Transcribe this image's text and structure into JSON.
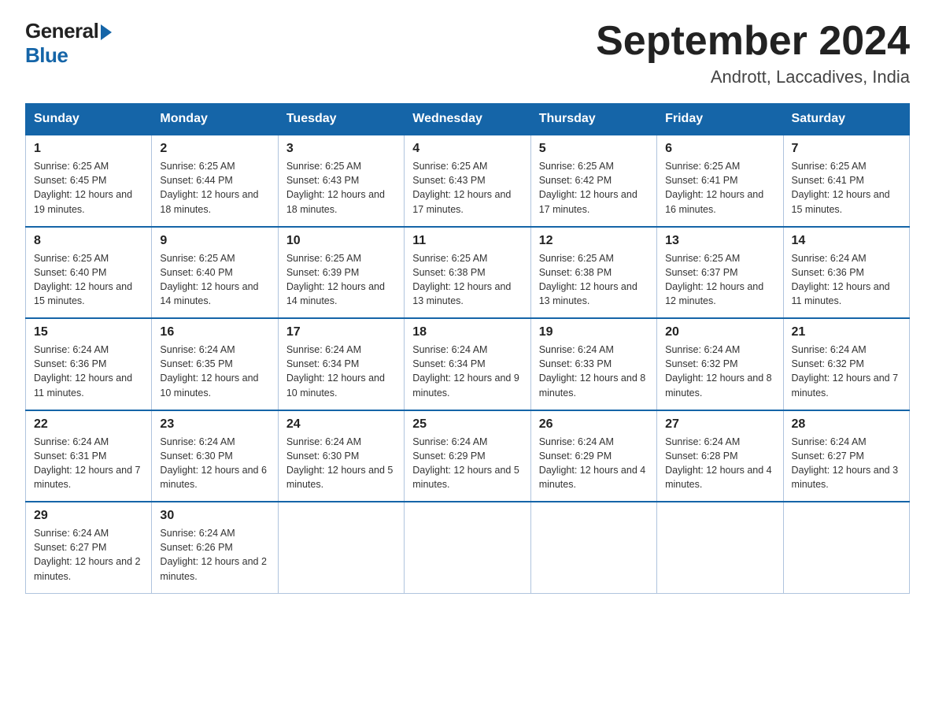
{
  "logo": {
    "text_general": "General",
    "text_blue": "Blue"
  },
  "title": "September 2024",
  "subtitle": "Andrott, Laccadives, India",
  "days_of_week": [
    "Sunday",
    "Monday",
    "Tuesday",
    "Wednesday",
    "Thursday",
    "Friday",
    "Saturday"
  ],
  "weeks": [
    [
      {
        "day": "1",
        "sunrise": "6:25 AM",
        "sunset": "6:45 PM",
        "daylight": "12 hours and 19 minutes."
      },
      {
        "day": "2",
        "sunrise": "6:25 AM",
        "sunset": "6:44 PM",
        "daylight": "12 hours and 18 minutes."
      },
      {
        "day": "3",
        "sunrise": "6:25 AM",
        "sunset": "6:43 PM",
        "daylight": "12 hours and 18 minutes."
      },
      {
        "day": "4",
        "sunrise": "6:25 AM",
        "sunset": "6:43 PM",
        "daylight": "12 hours and 17 minutes."
      },
      {
        "day": "5",
        "sunrise": "6:25 AM",
        "sunset": "6:42 PM",
        "daylight": "12 hours and 17 minutes."
      },
      {
        "day": "6",
        "sunrise": "6:25 AM",
        "sunset": "6:41 PM",
        "daylight": "12 hours and 16 minutes."
      },
      {
        "day": "7",
        "sunrise": "6:25 AM",
        "sunset": "6:41 PM",
        "daylight": "12 hours and 15 minutes."
      }
    ],
    [
      {
        "day": "8",
        "sunrise": "6:25 AM",
        "sunset": "6:40 PM",
        "daylight": "12 hours and 15 minutes."
      },
      {
        "day": "9",
        "sunrise": "6:25 AM",
        "sunset": "6:40 PM",
        "daylight": "12 hours and 14 minutes."
      },
      {
        "day": "10",
        "sunrise": "6:25 AM",
        "sunset": "6:39 PM",
        "daylight": "12 hours and 14 minutes."
      },
      {
        "day": "11",
        "sunrise": "6:25 AM",
        "sunset": "6:38 PM",
        "daylight": "12 hours and 13 minutes."
      },
      {
        "day": "12",
        "sunrise": "6:25 AM",
        "sunset": "6:38 PM",
        "daylight": "12 hours and 13 minutes."
      },
      {
        "day": "13",
        "sunrise": "6:25 AM",
        "sunset": "6:37 PM",
        "daylight": "12 hours and 12 minutes."
      },
      {
        "day": "14",
        "sunrise": "6:24 AM",
        "sunset": "6:36 PM",
        "daylight": "12 hours and 11 minutes."
      }
    ],
    [
      {
        "day": "15",
        "sunrise": "6:24 AM",
        "sunset": "6:36 PM",
        "daylight": "12 hours and 11 minutes."
      },
      {
        "day": "16",
        "sunrise": "6:24 AM",
        "sunset": "6:35 PM",
        "daylight": "12 hours and 10 minutes."
      },
      {
        "day": "17",
        "sunrise": "6:24 AM",
        "sunset": "6:34 PM",
        "daylight": "12 hours and 10 minutes."
      },
      {
        "day": "18",
        "sunrise": "6:24 AM",
        "sunset": "6:34 PM",
        "daylight": "12 hours and 9 minutes."
      },
      {
        "day": "19",
        "sunrise": "6:24 AM",
        "sunset": "6:33 PM",
        "daylight": "12 hours and 8 minutes."
      },
      {
        "day": "20",
        "sunrise": "6:24 AM",
        "sunset": "6:32 PM",
        "daylight": "12 hours and 8 minutes."
      },
      {
        "day": "21",
        "sunrise": "6:24 AM",
        "sunset": "6:32 PM",
        "daylight": "12 hours and 7 minutes."
      }
    ],
    [
      {
        "day": "22",
        "sunrise": "6:24 AM",
        "sunset": "6:31 PM",
        "daylight": "12 hours and 7 minutes."
      },
      {
        "day": "23",
        "sunrise": "6:24 AM",
        "sunset": "6:30 PM",
        "daylight": "12 hours and 6 minutes."
      },
      {
        "day": "24",
        "sunrise": "6:24 AM",
        "sunset": "6:30 PM",
        "daylight": "12 hours and 5 minutes."
      },
      {
        "day": "25",
        "sunrise": "6:24 AM",
        "sunset": "6:29 PM",
        "daylight": "12 hours and 5 minutes."
      },
      {
        "day": "26",
        "sunrise": "6:24 AM",
        "sunset": "6:29 PM",
        "daylight": "12 hours and 4 minutes."
      },
      {
        "day": "27",
        "sunrise": "6:24 AM",
        "sunset": "6:28 PM",
        "daylight": "12 hours and 4 minutes."
      },
      {
        "day": "28",
        "sunrise": "6:24 AM",
        "sunset": "6:27 PM",
        "daylight": "12 hours and 3 minutes."
      }
    ],
    [
      {
        "day": "29",
        "sunrise": "6:24 AM",
        "sunset": "6:27 PM",
        "daylight": "12 hours and 2 minutes."
      },
      {
        "day": "30",
        "sunrise": "6:24 AM",
        "sunset": "6:26 PM",
        "daylight": "12 hours and 2 minutes."
      },
      null,
      null,
      null,
      null,
      null
    ]
  ]
}
